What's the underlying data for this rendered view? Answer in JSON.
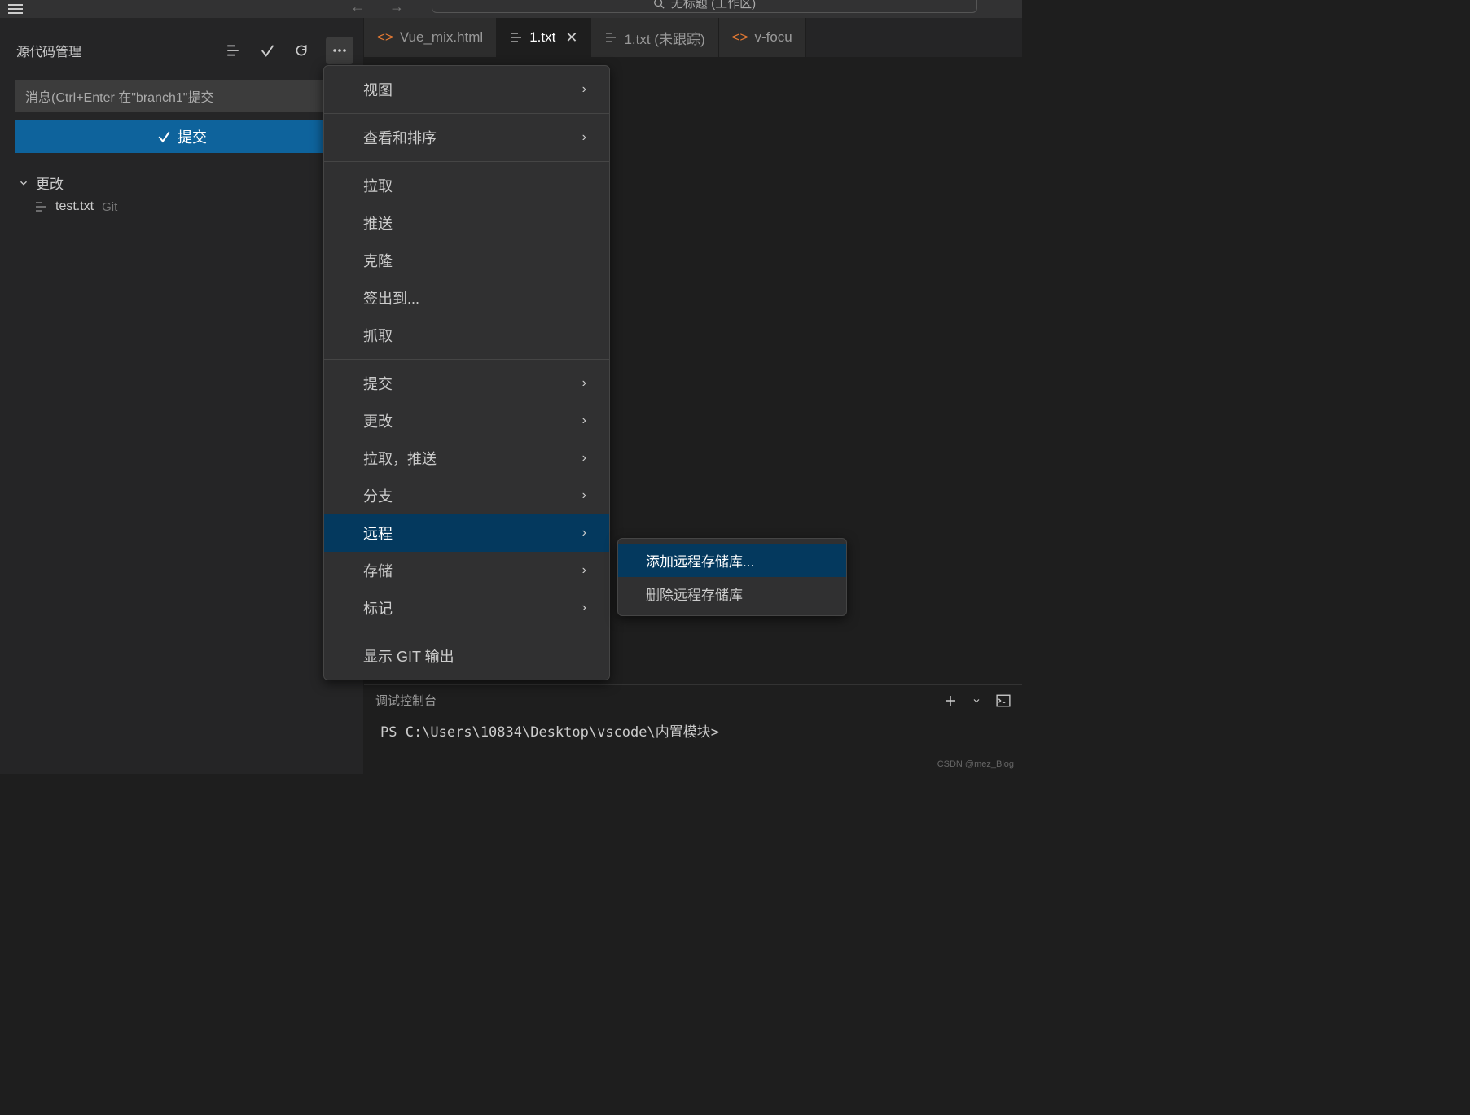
{
  "titlebar": {
    "search_text": "无标题 (工作区)"
  },
  "scm": {
    "title": "源代码管理",
    "commit_placeholder": "消息(Ctrl+Enter 在\"branch1\"提交",
    "commit_button": "提交",
    "changes_label": "更改",
    "file_name": "test.txt",
    "file_repo": "Git"
  },
  "tabs": [
    {
      "label": "Vue_mix.html",
      "icon": "code"
    },
    {
      "label": "1.txt",
      "icon": "text",
      "active": true,
      "closable": true
    },
    {
      "label": "1.txt (未跟踪)",
      "icon": "text"
    },
    {
      "label": "v-focu",
      "icon": "code"
    }
  ],
  "menu": {
    "items": [
      {
        "label": "视图",
        "sub": true
      },
      {
        "divider": true
      },
      {
        "label": "查看和排序",
        "sub": true
      },
      {
        "divider": true
      },
      {
        "label": "拉取"
      },
      {
        "label": "推送"
      },
      {
        "label": "克隆"
      },
      {
        "label": "签出到..."
      },
      {
        "label": "抓取"
      },
      {
        "divider": true
      },
      {
        "label": "提交",
        "sub": true
      },
      {
        "label": "更改",
        "sub": true
      },
      {
        "label": "拉取，推送",
        "sub": true
      },
      {
        "label": "分支",
        "sub": true
      },
      {
        "label": "远程",
        "sub": true,
        "highlighted": true
      },
      {
        "label": "存储",
        "sub": true
      },
      {
        "label": "标记",
        "sub": true
      },
      {
        "divider": true
      },
      {
        "label": "显示 GIT 输出"
      }
    ]
  },
  "submenu": {
    "items": [
      {
        "label": "添加远程存储库...",
        "highlighted": true
      },
      {
        "label": "删除远程存储库"
      }
    ]
  },
  "terminal": {
    "tab_label": "调试控制台",
    "prompt": "PS C:\\Users\\10834\\Desktop\\vscode\\内置模块>"
  },
  "watermark": "CSDN @mez_Blog"
}
